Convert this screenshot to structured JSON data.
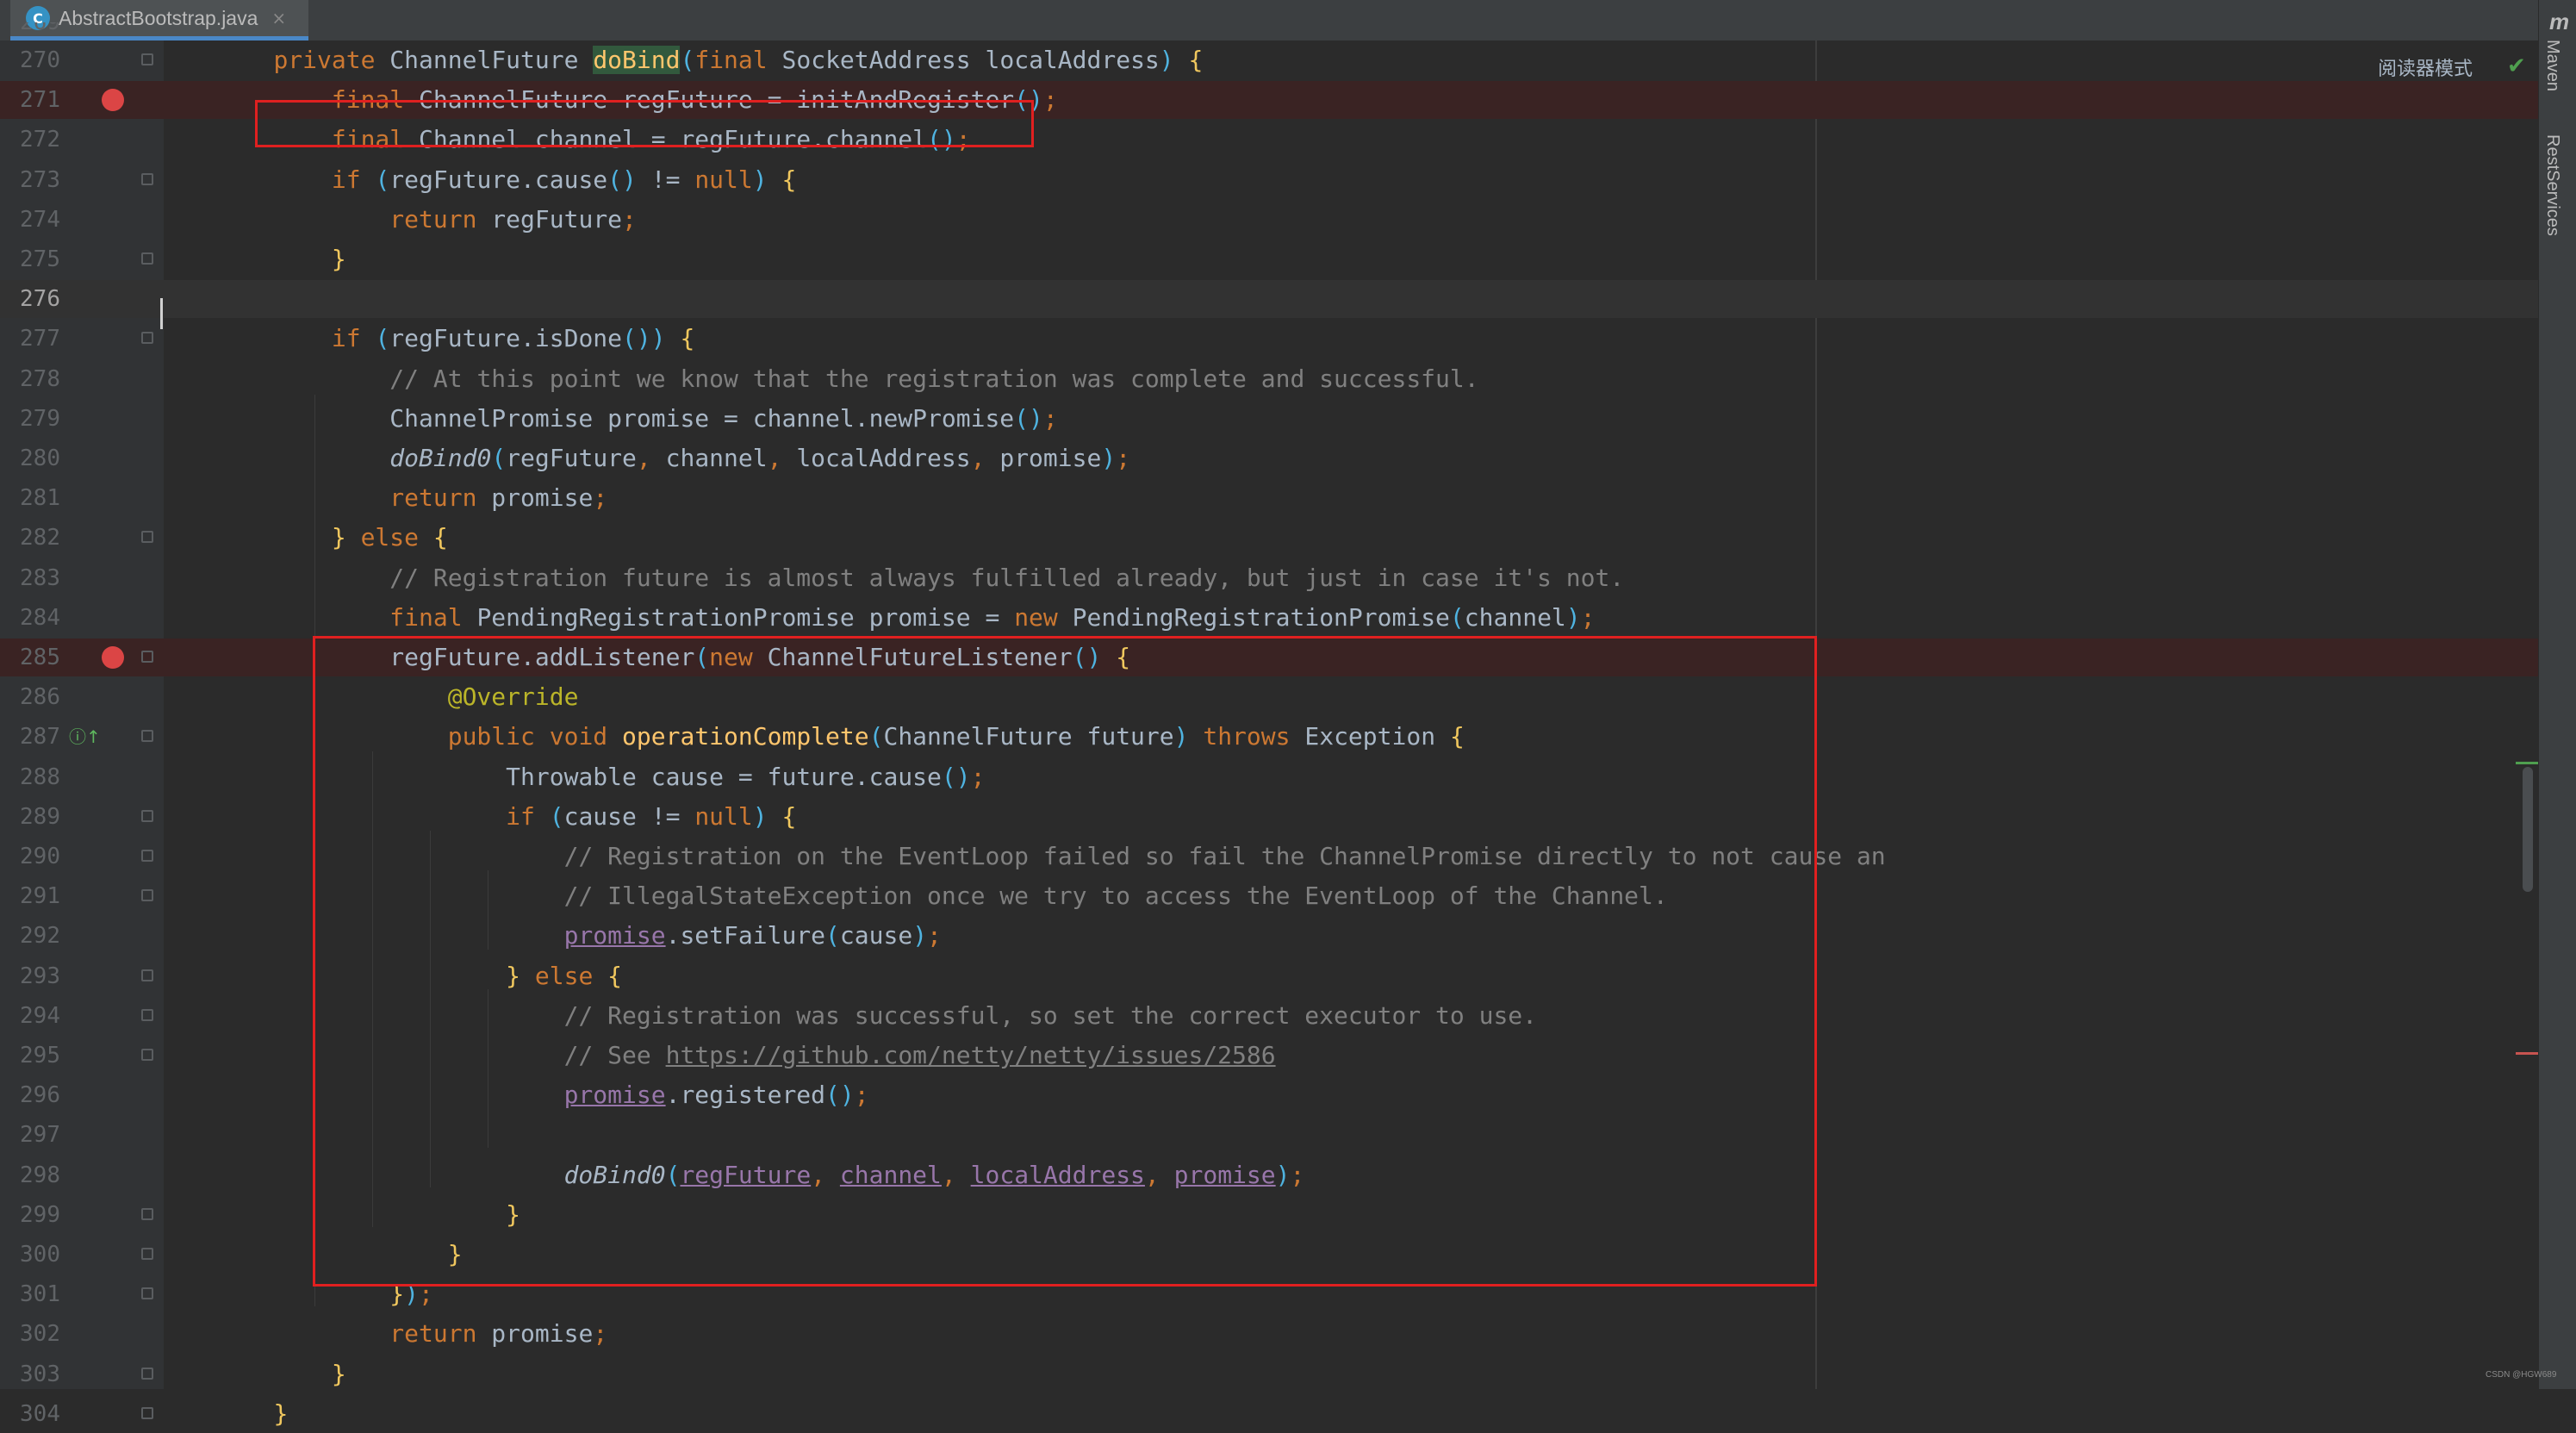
{
  "tab": {
    "filename": "AbstractBootstrap.java",
    "close_glyph": "×",
    "icon_letter": "C"
  },
  "toolbar": {
    "reader_mode": "阅读器模式",
    "status_check": "✔"
  },
  "right_panel": {
    "logo": "m",
    "maven": "Maven",
    "rest_services": "RestServices"
  },
  "watermark": "CSDN @HGW689",
  "colors": {
    "keyword": "#cc7832",
    "method": "#ffc66d",
    "comment": "#808080",
    "annotation": "#bbb529",
    "field": "#9876aa",
    "breakpoint": "#db4545",
    "highlight_box": "#e02020"
  },
  "gutter": {
    "partial_top_line": "269",
    "current_line": "276",
    "breakpoint_lines": [
      "271",
      "285"
    ],
    "override_icon_line": "287"
  },
  "lines": [
    {
      "num": "270",
      "code": "    private ChannelFuture doBind(final SocketAddress localAddress) {"
    },
    {
      "num": "271",
      "code": "        final ChannelFuture regFuture = initAndRegister();"
    },
    {
      "num": "272",
      "code": "        final Channel channel = regFuture.channel();"
    },
    {
      "num": "273",
      "code": "        if (regFuture.cause() != null) {"
    },
    {
      "num": "274",
      "code": "            return regFuture;"
    },
    {
      "num": "275",
      "code": "        }"
    },
    {
      "num": "276",
      "code": ""
    },
    {
      "num": "277",
      "code": "        if (regFuture.isDone()) {"
    },
    {
      "num": "278",
      "code": "            // At this point we know that the registration was complete and successful."
    },
    {
      "num": "279",
      "code": "            ChannelPromise promise = channel.newPromise();"
    },
    {
      "num": "280",
      "code": "            doBind0(regFuture, channel, localAddress, promise);"
    },
    {
      "num": "281",
      "code": "            return promise;"
    },
    {
      "num": "282",
      "code": "        } else {"
    },
    {
      "num": "283",
      "code": "            // Registration future is almost always fulfilled already, but just in case it's not."
    },
    {
      "num": "284",
      "code": "            final PendingRegistrationPromise promise = new PendingRegistrationPromise(channel);"
    },
    {
      "num": "285",
      "code": "            regFuture.addListener(new ChannelFutureListener() {"
    },
    {
      "num": "286",
      "code": "                @Override"
    },
    {
      "num": "287",
      "code": "                public void operationComplete(ChannelFuture future) throws Exception {"
    },
    {
      "num": "288",
      "code": "                    Throwable cause = future.cause();"
    },
    {
      "num": "289",
      "code": "                    if (cause != null) {"
    },
    {
      "num": "290",
      "code": "                        // Registration on the EventLoop failed so fail the ChannelPromise directly to not cause an"
    },
    {
      "num": "291",
      "code": "                        // IllegalStateException once we try to access the EventLoop of the Channel."
    },
    {
      "num": "292",
      "code": "                        promise.setFailure(cause);"
    },
    {
      "num": "293",
      "code": "                    } else {"
    },
    {
      "num": "294",
      "code": "                        // Registration was successful, so set the correct executor to use."
    },
    {
      "num": "295",
      "code": "                        // See https://github.com/netty/netty/issues/2586"
    },
    {
      "num": "296",
      "code": "                        promise.registered();"
    },
    {
      "num": "297",
      "code": ""
    },
    {
      "num": "298",
      "code": "                        doBind0(regFuture, channel, localAddress, promise);"
    },
    {
      "num": "299",
      "code": "                    }"
    },
    {
      "num": "300",
      "code": "                }"
    },
    {
      "num": "301",
      "code": "            });"
    },
    {
      "num": "302",
      "code": "            return promise;"
    },
    {
      "num": "303",
      "code": "        }"
    },
    {
      "num": "304",
      "code": "    }"
    }
  ]
}
